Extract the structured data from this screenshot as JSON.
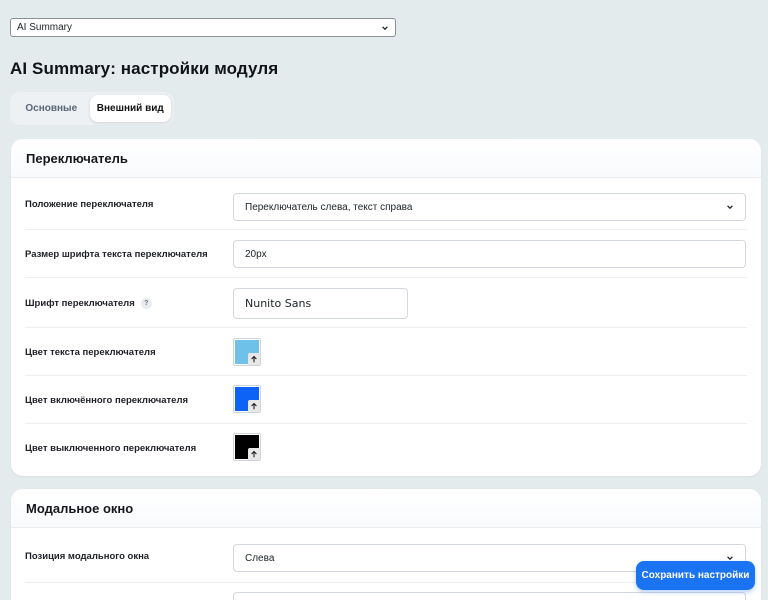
{
  "module_select": {
    "value": "AI Summary"
  },
  "page_title": "AI Summary: настройки модуля",
  "tabs": [
    {
      "label": "Основные",
      "active": false
    },
    {
      "label": "Внешний вид",
      "active": true
    }
  ],
  "section_switcher": {
    "title": "Переключатель",
    "position": {
      "label": "Положение переключателя",
      "value": "Переключатель слева, текст справа"
    },
    "font_size": {
      "label": "Размер шрифта текста переключателя",
      "value": "20px"
    },
    "font": {
      "label": "Шрифт переключателя",
      "help": "?",
      "value": "Nunito Sans"
    },
    "text_color": {
      "label": "Цвет текста переключателя",
      "color": "#6ec2ea"
    },
    "on_color": {
      "label": "Цвет включённого переключателя",
      "color": "#0d63f5"
    },
    "off_color": {
      "label": "Цвет выключенного переключателя",
      "color": "#000000"
    }
  },
  "section_modal": {
    "title": "Модальное окно",
    "position": {
      "label": "Позиция модального окна",
      "value": "Слева"
    }
  },
  "save_button": {
    "label": "Сохранить настройки"
  },
  "colors": {
    "accent": "#1a73f0",
    "background": "#e4ebed"
  }
}
